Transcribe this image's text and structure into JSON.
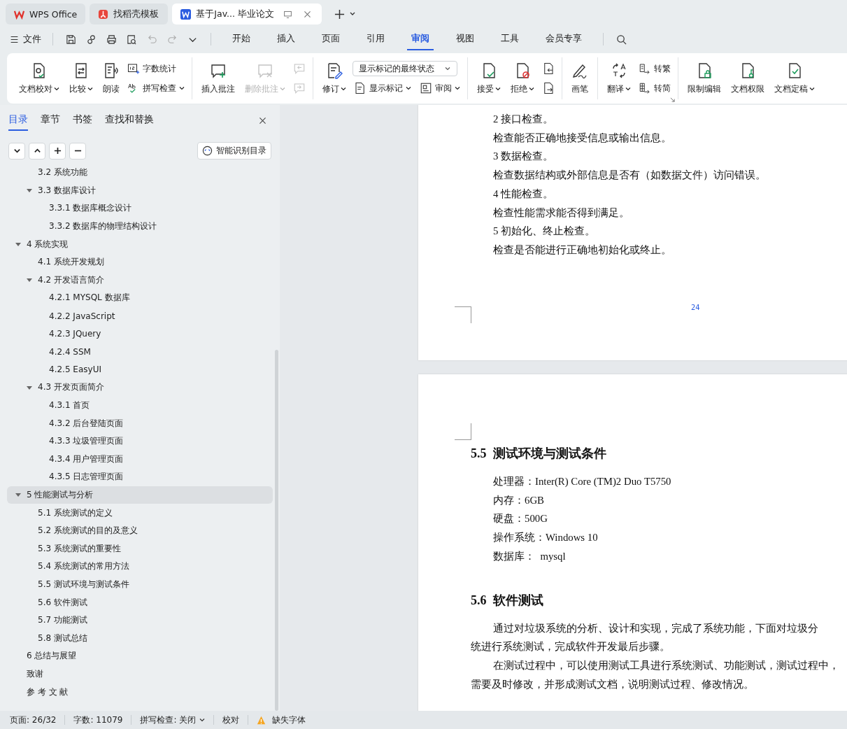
{
  "window_tabs": [
    {
      "label": "WPS Office",
      "selected": false
    },
    {
      "label": "找稻壳模板",
      "selected": false
    },
    {
      "label": "基于Jav... 毕业论文",
      "selected": true
    }
  ],
  "menu": {
    "file": "文件",
    "tabs": [
      {
        "label": "开始",
        "selected": false
      },
      {
        "label": "插入",
        "selected": false
      },
      {
        "label": "页面",
        "selected": false
      },
      {
        "label": "引用",
        "selected": false
      },
      {
        "label": "审阅",
        "selected": true
      },
      {
        "label": "视图",
        "selected": false
      },
      {
        "label": "工具",
        "selected": false
      },
      {
        "label": "会员专享",
        "selected": false
      }
    ]
  },
  "ribbon": {
    "groups": [
      {
        "items": [
          {
            "kind": "large",
            "label": "文档校对",
            "dropdown": true,
            "disabled": false
          },
          {
            "kind": "large",
            "label": "比较",
            "dropdown": true,
            "disabled": false
          },
          {
            "kind": "large",
            "label": "朗读",
            "dropdown": false,
            "disabled": false
          },
          {
            "kind": "column",
            "rows": [
              [
                {
                  "kind": "small",
                  "label": "字数统计",
                  "dropdown": false,
                  "disabled": false
                }
              ],
              [
                {
                  "kind": "small",
                  "label": "拼写检查",
                  "dropdown": true,
                  "disabled": false
                }
              ]
            ]
          }
        ]
      },
      {
        "items": [
          {
            "kind": "large",
            "label": "插入批注",
            "dropdown": false,
            "disabled": false
          },
          {
            "kind": "large",
            "label": "删除批注",
            "dropdown": true,
            "disabled": true
          },
          {
            "kind": "column",
            "rows": [
              [
                {
                  "kind": "small",
                  "dropdown": false,
                  "disabled": true
                }
              ],
              [
                {
                  "kind": "small",
                  "dropdown": false,
                  "disabled": true
                }
              ]
            ]
          }
        ]
      },
      {
        "items": [
          {
            "kind": "large",
            "label": "修订",
            "dropdown": true,
            "disabled": false
          },
          {
            "kind": "column",
            "rows": [
              [
                {
                  "kind": "select",
                  "value": "显示标记的最终状态"
                }
              ],
              [
                {
                  "kind": "small",
                  "label": "显示标记",
                  "dropdown": true,
                  "disabled": false
                },
                {
                  "kind": "small",
                  "label": "审阅",
                  "dropdown": true,
                  "disabled": false
                }
              ]
            ]
          }
        ]
      },
      {
        "items": [
          {
            "kind": "large",
            "label": "接受",
            "dropdown": true,
            "disabled": false
          },
          {
            "kind": "large",
            "label": "拒绝",
            "dropdown": true,
            "disabled": false
          },
          {
            "kind": "column",
            "rows": [
              [
                {
                  "kind": "small",
                  "dropdown": false,
                  "disabled": false
                }
              ],
              [
                {
                  "kind": "small",
                  "dropdown": false,
                  "disabled": false
                }
              ]
            ]
          }
        ]
      },
      {
        "items": [
          {
            "kind": "large",
            "label": "画笔",
            "dropdown": false,
            "disabled": false
          }
        ]
      },
      {
        "items": [
          {
            "kind": "large",
            "label": "翻译",
            "dropdown": true,
            "disabled": false
          },
          {
            "kind": "column",
            "rows": [
              [
                {
                  "kind": "small",
                  "label": "转繁",
                  "dropdown": false,
                  "disabled": false
                }
              ],
              [
                {
                  "kind": "small",
                  "label": "转简",
                  "dropdown": false,
                  "disabled": false
                }
              ]
            ]
          }
        ]
      },
      {
        "items": [
          {
            "kind": "large",
            "label": "限制编辑",
            "dropdown": false,
            "disabled": false
          },
          {
            "kind": "large",
            "label": "文档权限",
            "dropdown": false,
            "disabled": false
          },
          {
            "kind": "large",
            "label": "文档定稿",
            "dropdown": true,
            "disabled": false
          }
        ]
      }
    ]
  },
  "panel": {
    "tabs": [
      {
        "label": "目录",
        "selected": true
      },
      {
        "label": "章节",
        "selected": false
      },
      {
        "label": "书签",
        "selected": false
      },
      {
        "label": "查找和替换",
        "selected": false
      }
    ],
    "smart_button": "智能识别目录",
    "toc": {
      "items": [
        {
          "children": [
            {
              "label": "3.2  系统功能",
              "selected": false
            },
            {
              "label": "3.3  数据库设计",
              "selected": false,
              "expanded": true,
              "children": [
                {
                  "label": "3.3.1 数据库概念设计",
                  "selected": false
                },
                {
                  "label": "3.3.2 数据库的物理结构设计",
                  "selected": false
                }
              ]
            }
          ]
        },
        {
          "label": "4  系统实现",
          "selected": false,
          "expanded": true,
          "children": [
            {
              "label": "4.1  系统开发规划",
              "selected": false
            },
            {
              "label": "4.2  开发语言简介",
              "selected": false,
              "expanded": true,
              "children": [
                {
                  "label": "4.2.1 MYSQL 数据库",
                  "selected": false
                },
                {
                  "label": "4.2.2 JavaScript",
                  "selected": false
                },
                {
                  "label": "4.2.3 JQuery",
                  "selected": false
                },
                {
                  "label": "4.2.4 SSM",
                  "selected": false
                },
                {
                  "label": "4.2.5 EasyUI",
                  "selected": false
                }
              ]
            },
            {
              "label": "4.3  开发页面简介",
              "selected": false,
              "expanded": true,
              "children": [
                {
                  "label": "4.3.1 首页",
                  "selected": false
                },
                {
                  "label": "4.3.2 后台登陆页面",
                  "selected": false
                },
                {
                  "label": "4.3.3 垃圾管理页面",
                  "selected": false
                },
                {
                  "label": "4.3.4 用户管理页面",
                  "selected": false
                },
                {
                  "label": "4.3.5 日志管理页面",
                  "selected": false
                }
              ]
            }
          ]
        },
        {
          "label": "5  性能测试与分析",
          "selected": true,
          "expanded": true,
          "children": [
            {
              "label": "5.1  系统测试的定义",
              "selected": false
            },
            {
              "label": "5.2  系统测试的目的及意义",
              "selected": false
            },
            {
              "label": "5.3  系统测试的重要性",
              "selected": false
            },
            {
              "label": "5.4  系统测试的常用方法",
              "selected": false
            },
            {
              "label": "5.5  测试环境与测试条件",
              "selected": false
            },
            {
              "label": "5.6  软件测试",
              "selected": false
            },
            {
              "label": "5.7  功能测试",
              "selected": false
            },
            {
              "label": "5.8  测试总结",
              "selected": false
            }
          ]
        },
        {
          "label": "6  总结与展望",
          "selected": false
        },
        {
          "label": "致谢",
          "selected": false
        },
        {
          "label": "参 考 文 献",
          "selected": false
        }
      ]
    }
  },
  "pages": [
    {
      "blocks": [
        {
          "kind": "line",
          "text": "2 接口检查。"
        },
        {
          "kind": "line",
          "text": "检查能否正确地接受信息或输出信息。"
        },
        {
          "kind": "line",
          "text": "3 数据检查。"
        },
        {
          "kind": "line",
          "text": "检查数据结构或外部信息是否有（如数据文件）访问错误。"
        },
        {
          "kind": "line",
          "text": "4 性能检查。"
        },
        {
          "kind": "line",
          "text": "检查性能需求能否得到满足。"
        },
        {
          "kind": "line",
          "text": "5 初始化、终止检查。"
        },
        {
          "kind": "line",
          "text": "检查是否能进行正确地初始化或终止。"
        }
      ],
      "page_number": "24"
    },
    {
      "blocks": [
        {
          "kind": "heading",
          "text": "5.5  测试环境与测试条件"
        },
        {
          "kind": "line",
          "text": "处理器：Inter(R) Core (TM)2 Duo T5750"
        },
        {
          "kind": "line",
          "text": "内存：6GB"
        },
        {
          "kind": "line",
          "text": "硬盘：500G"
        },
        {
          "kind": "line",
          "text": "操作系统：Windows 10"
        },
        {
          "kind": "line",
          "text": "数据库：  mysql"
        },
        {
          "kind": "heading",
          "text": "5.6  软件测试"
        },
        {
          "kind": "first",
          "text": "通过对垃圾系统的分析、设计和实现，完成了系统功能，下面对垃圾分"
        },
        {
          "kind": "cont",
          "text": "统进行系统测试，完成软件开发最后步骤。"
        },
        {
          "kind": "first",
          "text": "在测试过程中，可以使用测试工具进行系统测试、功能测试，测试过程中，"
        },
        {
          "kind": "cont",
          "text": "需要及时修改，并形成测试文档，说明测试过程、修改情况。"
        }
      ]
    }
  ],
  "status_bar": {
    "page": "页面: 26/32",
    "words": "字数: 11079",
    "spell": "拼写检查: 关闭",
    "proof": "校对",
    "missing_font": "缺失字体"
  }
}
